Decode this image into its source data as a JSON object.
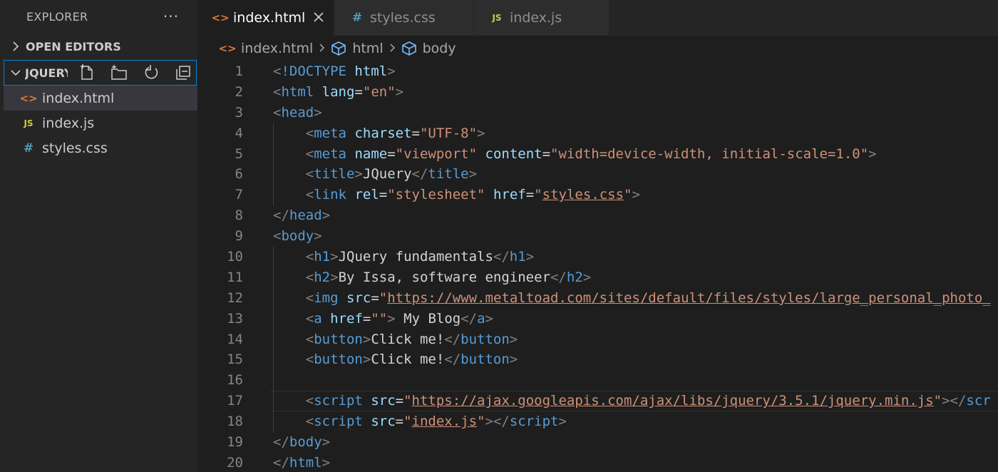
{
  "sidebar": {
    "title": "EXPLORER",
    "more": "···",
    "open_editors": "OPEN EDITORS",
    "folder": "JQUERY",
    "files": [
      {
        "icon": "<>",
        "name": "index.html"
      },
      {
        "icon": "JS",
        "name": "index.js"
      },
      {
        "icon": "#",
        "name": "styles.css"
      }
    ]
  },
  "tabs": [
    {
      "icon": "<>",
      "label": "index.html"
    },
    {
      "icon": "#",
      "label": "styles.css"
    },
    {
      "icon": "JS",
      "label": "index.js"
    }
  ],
  "breadcrumb": {
    "file_icon": "<>",
    "file": "index.html",
    "sep": ">",
    "items": [
      "html",
      "body"
    ]
  },
  "colors": {
    "accent": "#007fd4",
    "html_icon": "#e37933",
    "js_icon": "#cbcb41",
    "css_icon": "#519aba"
  },
  "editor": {
    "line_numbers": [
      "1",
      "2",
      "3",
      "4",
      "5",
      "6",
      "7",
      "8",
      "9",
      "10",
      "11",
      "12",
      "13",
      "14",
      "15",
      "16",
      "17",
      "18",
      "19",
      "20"
    ],
    "current_line": 17,
    "lines": [
      [
        [
          "t",
          "<"
        ],
        [
          "tn",
          "!DOCTYPE"
        ],
        [
          "tx",
          " "
        ],
        [
          "an",
          "html"
        ],
        [
          "t",
          ">"
        ]
      ],
      [
        [
          "t",
          "<"
        ],
        [
          "tn",
          "html"
        ],
        [
          "tx",
          " "
        ],
        [
          "an",
          "lang"
        ],
        [
          "tx",
          "="
        ],
        [
          "av",
          "\"en\""
        ],
        [
          "t",
          ">"
        ]
      ],
      [
        [
          "t",
          "<"
        ],
        [
          "tn",
          "head"
        ],
        [
          "t",
          ">"
        ]
      ],
      [
        [
          "tx",
          "    "
        ],
        [
          "t",
          "<"
        ],
        [
          "tn",
          "meta"
        ],
        [
          "tx",
          " "
        ],
        [
          "an",
          "charset"
        ],
        [
          "tx",
          "="
        ],
        [
          "av",
          "\"UTF-8\""
        ],
        [
          "t",
          ">"
        ]
      ],
      [
        [
          "tx",
          "    "
        ],
        [
          "t",
          "<"
        ],
        [
          "tn",
          "meta"
        ],
        [
          "tx",
          " "
        ],
        [
          "an",
          "name"
        ],
        [
          "tx",
          "="
        ],
        [
          "av",
          "\"viewport\""
        ],
        [
          "tx",
          " "
        ],
        [
          "an",
          "content"
        ],
        [
          "tx",
          "="
        ],
        [
          "av",
          "\"width=device-width, initial-scale=1.0\""
        ],
        [
          "t",
          ">"
        ]
      ],
      [
        [
          "tx",
          "    "
        ],
        [
          "t",
          "<"
        ],
        [
          "tn",
          "title"
        ],
        [
          "t",
          ">"
        ],
        [
          "tx",
          "JQuery"
        ],
        [
          "t",
          "</"
        ],
        [
          "tn",
          "title"
        ],
        [
          "t",
          ">"
        ]
      ],
      [
        [
          "tx",
          "    "
        ],
        [
          "t",
          "<"
        ],
        [
          "tn",
          "link"
        ],
        [
          "tx",
          " "
        ],
        [
          "an",
          "rel"
        ],
        [
          "tx",
          "="
        ],
        [
          "av",
          "\"stylesheet\""
        ],
        [
          "tx",
          " "
        ],
        [
          "an",
          "href"
        ],
        [
          "tx",
          "="
        ],
        [
          "av",
          "\""
        ],
        [
          "avu",
          "styles.css"
        ],
        [
          "av",
          "\""
        ],
        [
          "t",
          ">"
        ]
      ],
      [
        [
          "t",
          "</"
        ],
        [
          "tn",
          "head"
        ],
        [
          "t",
          ">"
        ]
      ],
      [
        [
          "t",
          "<"
        ],
        [
          "tn",
          "body"
        ],
        [
          "t",
          ">"
        ]
      ],
      [
        [
          "tx",
          "    "
        ],
        [
          "t",
          "<"
        ],
        [
          "tn",
          "h1"
        ],
        [
          "t",
          ">"
        ],
        [
          "tx",
          "JQuery fundamentals"
        ],
        [
          "t",
          "</"
        ],
        [
          "tn",
          "h1"
        ],
        [
          "t",
          ">"
        ]
      ],
      [
        [
          "tx",
          "    "
        ],
        [
          "t",
          "<"
        ],
        [
          "tn",
          "h2"
        ],
        [
          "t",
          ">"
        ],
        [
          "tx",
          "By Issa, software engineer"
        ],
        [
          "t",
          "</"
        ],
        [
          "tn",
          "h2"
        ],
        [
          "t",
          ">"
        ]
      ],
      [
        [
          "tx",
          "    "
        ],
        [
          "t",
          "<"
        ],
        [
          "tn",
          "img"
        ],
        [
          "tx",
          " "
        ],
        [
          "an",
          "src"
        ],
        [
          "tx",
          "="
        ],
        [
          "av",
          "\""
        ],
        [
          "avu",
          "https://www.metaltoad.com/sites/default/files/styles/large_personal_photo_"
        ]
      ],
      [
        [
          "tx",
          "    "
        ],
        [
          "t",
          "<"
        ],
        [
          "tn",
          "a"
        ],
        [
          "tx",
          " "
        ],
        [
          "an",
          "href"
        ],
        [
          "tx",
          "="
        ],
        [
          "av",
          "\"\""
        ],
        [
          "t",
          ">"
        ],
        [
          "tx",
          " My Blog"
        ],
        [
          "t",
          "</"
        ],
        [
          "tn",
          "a"
        ],
        [
          "t",
          ">"
        ]
      ],
      [
        [
          "tx",
          "    "
        ],
        [
          "t",
          "<"
        ],
        [
          "tn",
          "button"
        ],
        [
          "t",
          ">"
        ],
        [
          "tx",
          "Click me!"
        ],
        [
          "t",
          "</"
        ],
        [
          "tn",
          "button"
        ],
        [
          "t",
          ">"
        ]
      ],
      [
        [
          "tx",
          "    "
        ],
        [
          "t",
          "<"
        ],
        [
          "tn",
          "button"
        ],
        [
          "t",
          ">"
        ],
        [
          "tx",
          "Click me!"
        ],
        [
          "t",
          "</"
        ],
        [
          "tn",
          "button"
        ],
        [
          "t",
          ">"
        ]
      ],
      [],
      [
        [
          "tx",
          "    "
        ],
        [
          "t",
          "<"
        ],
        [
          "tn",
          "script"
        ],
        [
          "tx",
          " "
        ],
        [
          "an",
          "src"
        ],
        [
          "tx",
          "="
        ],
        [
          "av",
          "\""
        ],
        [
          "avu",
          "https://ajax.googleapis.com/ajax/libs/jquery/3.5.1/jquery.min.js"
        ],
        [
          "av",
          "\""
        ],
        [
          "t",
          "></"
        ],
        [
          "tn",
          "scr"
        ]
      ],
      [
        [
          "tx",
          "    "
        ],
        [
          "t",
          "<"
        ],
        [
          "tn",
          "script"
        ],
        [
          "tx",
          " "
        ],
        [
          "an",
          "src"
        ],
        [
          "tx",
          "="
        ],
        [
          "av",
          "\""
        ],
        [
          "avu",
          "index.js"
        ],
        [
          "av",
          "\""
        ],
        [
          "t",
          "></"
        ],
        [
          "tn",
          "script"
        ],
        [
          "t",
          ">"
        ]
      ],
      [
        [
          "t",
          "</"
        ],
        [
          "tn",
          "body"
        ],
        [
          "t",
          ">"
        ]
      ],
      [
        [
          "t",
          "</"
        ],
        [
          "tn",
          "html"
        ],
        [
          "t",
          ">"
        ]
      ]
    ]
  }
}
